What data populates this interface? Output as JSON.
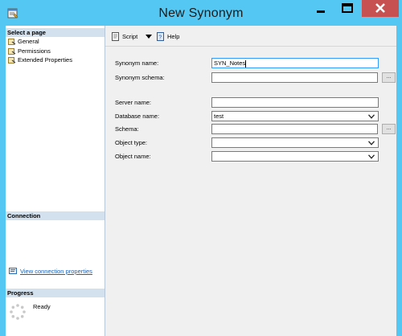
{
  "window": {
    "title": "New Synonym",
    "controls": [
      "minimize-icon",
      "maximize-icon",
      "close-icon"
    ],
    "close_color": "#c75050",
    "frame_color": "#54c8f3"
  },
  "left_pane": {
    "select_page_header": "Select a page",
    "pages": [
      {
        "label": "General",
        "icon": "page-wrench-icon"
      },
      {
        "label": "Permissions",
        "icon": "page-wrench-icon"
      },
      {
        "label": "Extended Properties",
        "icon": "page-wrench-icon"
      }
    ],
    "connection_header": "Connection",
    "connection_link": "View connection properties",
    "progress_header": "Progress",
    "progress_status": "Ready"
  },
  "toolbar": {
    "script_label": "Script",
    "help_label": "Help"
  },
  "form": {
    "synonym_name_label": "Synonym name:",
    "synonym_name_value": "SYN_Notes",
    "synonym_schema_label": "Synonym schema:",
    "synonym_schema_value": "",
    "server_name_label": "Server name:",
    "server_name_value": "",
    "database_name_label": "Database name:",
    "database_name_value": "test",
    "schema_label": "Schema:",
    "schema_value": "",
    "object_type_label": "Object type:",
    "object_type_value": "",
    "object_name_label": "Object name:",
    "object_name_value": "",
    "browse_label": "..."
  }
}
